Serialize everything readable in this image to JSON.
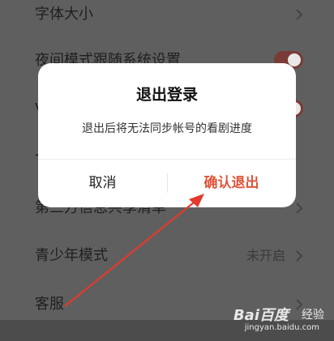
{
  "settings": {
    "rows": [
      {
        "label": "字体大小"
      },
      {
        "label": "夜间模式跟随系统设置"
      },
      {
        "label": "V"
      },
      {
        "label": "个"
      },
      {
        "label": "第三方信息共享清单"
      },
      {
        "label": "青少年模式",
        "value": "未开启"
      },
      {
        "label": "客服"
      }
    ]
  },
  "dialog": {
    "title": "退出登录",
    "message": "退出后将无法同步帐号的看剧进度",
    "cancel_label": "取消",
    "confirm_label": "确认退出"
  },
  "colors": {
    "accent": "#e0553a",
    "annotation_arrow": "#e23a2e",
    "toggle_on": "#7a3b36"
  },
  "watermark": {
    "brand": "Bai百度",
    "suffix": "经验",
    "url": "jingyan.baidu.com"
  }
}
